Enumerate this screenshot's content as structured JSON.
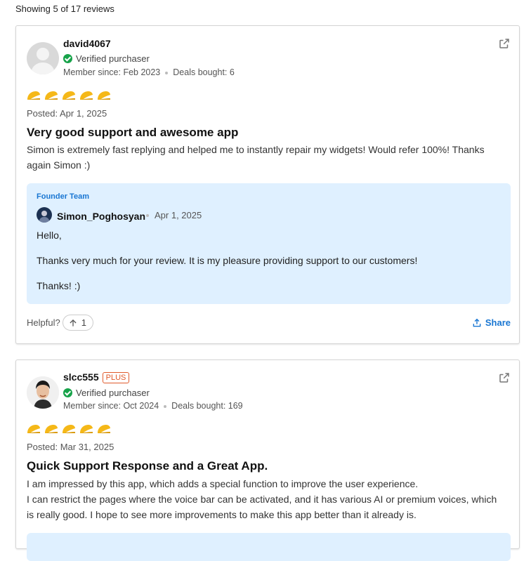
{
  "review_count_text": "Showing 5 of 17 reviews",
  "colors": {
    "accent": "#1976d2",
    "verified": "#17a34a",
    "plus_badge": "#e05a2b",
    "taco": "#f5b818",
    "reply_bg": "#dff0ff"
  },
  "reviews": [
    {
      "username": "david4067",
      "verified_label": "Verified purchaser",
      "member_since": "Member since: Feb 2023",
      "deals_bought": "Deals bought: 6",
      "rating": 5,
      "posted": "Posted: Apr 1, 2025",
      "title": "Very good support and awesome app",
      "body": "Simon is extremely fast replying and helped me to instantly repair my widgets! Would refer 100%! Thanks again Simon :)",
      "reply": {
        "team_label": "Founder Team",
        "author": "Simon_Poghosyan",
        "date": "Apr 1, 2025",
        "lines": [
          "Hello,",
          "Thanks very much for your review. It is my pleasure providing support to our customers!",
          "Thanks! :)"
        ]
      },
      "helpful_label": "Helpful?",
      "helpful_count": "1",
      "share_label": "Share"
    },
    {
      "username": "slcc555",
      "badge": "PLUS",
      "verified_label": "Verified purchaser",
      "member_since": "Member since: Oct 2024",
      "deals_bought": "Deals bought: 169",
      "rating": 5,
      "posted": "Posted: Mar 31, 2025",
      "title": "Quick Support Response and a Great App.",
      "body_lines": [
        "I am impressed by this app, which adds a special function to improve the user experience.",
        "I can restrict the pages where the voice bar can be activated, and it has various AI or premium voices, which is really good. I hope to see more improvements to make this app better than it already is."
      ]
    }
  ]
}
